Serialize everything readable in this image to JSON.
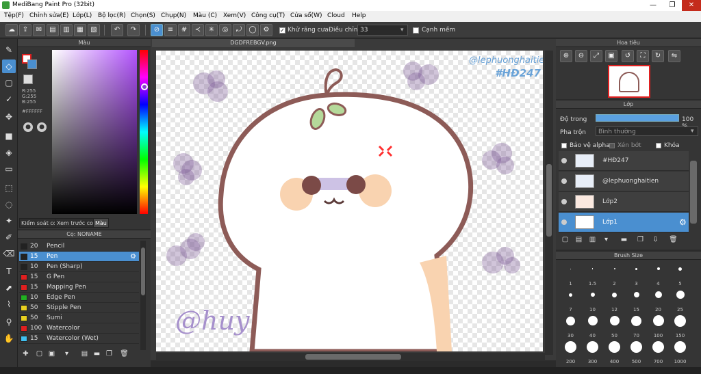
{
  "window": {
    "title": "MediBang Paint Pro (32bit)",
    "minimize": "—",
    "maximize": "❐",
    "close": "✕"
  },
  "menu": [
    "Tệp(F)",
    "Chỉnh sửa(E)",
    "Lớp(L)",
    "Bộ lọc(R)",
    "Chọn(S)",
    "Chụp(N)",
    "Màu (C)",
    "Xem(V)",
    "Công cụ(T)",
    "Cửa sổ(W)",
    "Cloud",
    "Help"
  ],
  "toolbar": {
    "antialias_label": "Khử răng cưa",
    "correction_label": "Điều chỉnh",
    "correction_value": "33",
    "edge_label": "Cạnh mềm"
  },
  "color_panel": {
    "title": "Màu",
    "r": "R:255",
    "g": "G:255",
    "b": "B:255",
    "hex": "#FFFFFF",
    "tabs": [
      "Kiểm soát co",
      "Xem trước co",
      "Màu"
    ]
  },
  "brush_panel": {
    "title": "Cọ: NONAME",
    "brushes": [
      {
        "size": "20",
        "name": "Pencil",
        "color": "#222222"
      },
      {
        "size": "15",
        "name": "Pen",
        "color": "#222222",
        "selected": true
      },
      {
        "size": "10",
        "name": "Pen (Sharp)",
        "color": "#222222"
      },
      {
        "size": "15",
        "name": "G Pen",
        "color": "#e02020"
      },
      {
        "size": "15",
        "name": "Mapping Pen",
        "color": "#e02020"
      },
      {
        "size": "10",
        "name": "Edge Pen",
        "color": "#22b022"
      },
      {
        "size": "50",
        "name": "Stipple Pen",
        "color": "#e8d020"
      },
      {
        "size": "50",
        "name": "Sumi",
        "color": "#e8d020"
      },
      {
        "size": "100",
        "name": "Watercolor",
        "color": "#e02020"
      },
      {
        "size": "15",
        "name": "Watercolor (Wet)",
        "color": "#40c0f0"
      }
    ]
  },
  "canvas": {
    "doc_tab": "DGDFREBGV.png",
    "watermark_top": "@lephuonghaitien",
    "hashtag": "#HĐ247",
    "signature": "@huy"
  },
  "navigator": {
    "title": "Hoa tiêu"
  },
  "layers": {
    "title": "Lớp",
    "opacity_label": "Độ trong",
    "opacity_value": "100 %",
    "opacity_fraction": 1.0,
    "blend_label": "Pha trộn",
    "blend_value": "Bình thường",
    "protect_alpha": "Bảo vệ alpha",
    "clipping": "Xén bớt",
    "lock": "Khóa",
    "items": [
      {
        "name": "#HĐ247",
        "selected": false
      },
      {
        "name": "@lephuonghaitien",
        "selected": false
      },
      {
        "name": "Lớp2",
        "selected": false
      },
      {
        "name": "Lớp1",
        "selected": true
      }
    ]
  },
  "brush_size": {
    "title": "Brush Size",
    "sizes": [
      "1",
      "1.5",
      "2",
      "3",
      "4",
      "5",
      "7",
      "10",
      "12",
      "15",
      "20",
      "25",
      "30",
      "40",
      "50",
      "70",
      "100",
      "150",
      "200",
      "300",
      "400",
      "500",
      "700",
      "1000"
    ]
  },
  "accent": "#4a8fd0",
  "line_color": "#8d5b57",
  "skin_color": "#f9d3b0"
}
